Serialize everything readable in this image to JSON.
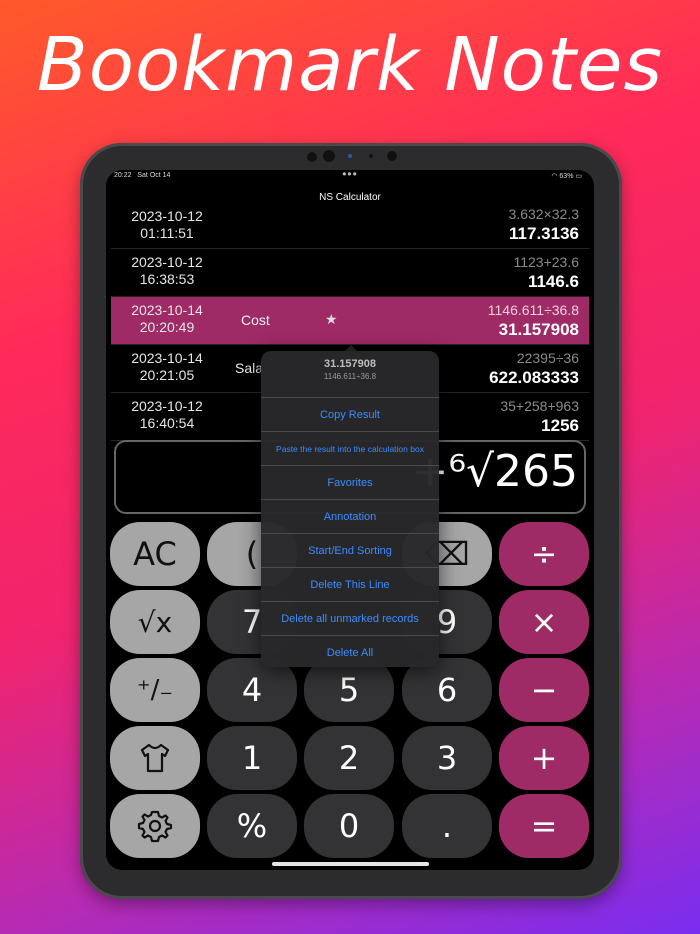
{
  "headline": "Bookmark Notes",
  "status": {
    "time": "20:22",
    "date": "Sat Oct 14",
    "battery": "63%"
  },
  "app_title": "NS Calculator",
  "history": [
    {
      "date": "2023-10-12",
      "time": "01:11:51",
      "expr": "3.632×32.3",
      "result": "117.3136",
      "note": "",
      "starred": false,
      "selected": false
    },
    {
      "date": "2023-10-12",
      "time": "16:38:53",
      "expr": "1123+23.6",
      "result": "1146.6",
      "note": "",
      "starred": false,
      "selected": false
    },
    {
      "date": "2023-10-14",
      "time": "20:20:49",
      "expr": "1146.611÷36.8",
      "result": "31.157908",
      "note": "Cost",
      "starred": true,
      "selected": true
    },
    {
      "date": "2023-10-14",
      "time": "20:21:05",
      "expr": "22395÷36",
      "result": "622.083333",
      "note": "Sala",
      "starred": false,
      "selected": false
    },
    {
      "date": "2023-10-12",
      "time": "16:40:54",
      "expr": "35+258+963",
      "result": "1256",
      "note": "",
      "starred": false,
      "selected": false
    }
  ],
  "display": {
    "expression": "+⁶√265"
  },
  "context_menu": {
    "result": "31.157908",
    "expression": "1146.611÷36.8",
    "items": [
      "Copy Result",
      "Paste the result into the calculation box",
      "Favorites",
      "Annotation",
      "Start/End Sorting",
      "Delete This Line",
      "Delete all unmarked records",
      "Delete All"
    ]
  },
  "keys": {
    "ac": "AC",
    "paren": "(",
    "backspace": "⌫",
    "divide": "÷",
    "sqrt": "√x",
    "seven": "7",
    "nine": "9",
    "multiply": "×",
    "plusminus": "⁺∕₋",
    "four": "4",
    "five": "5",
    "six": "6",
    "minus": "−",
    "shirt": "shirt-icon",
    "one": "1",
    "two": "2",
    "three": "3",
    "plus": "+",
    "settings": "gear-icon",
    "percent": "%",
    "zero": "0",
    "dot": ".",
    "equals": "="
  },
  "colors": {
    "accent": "#9e2a66",
    "link": "#3b8cff"
  }
}
